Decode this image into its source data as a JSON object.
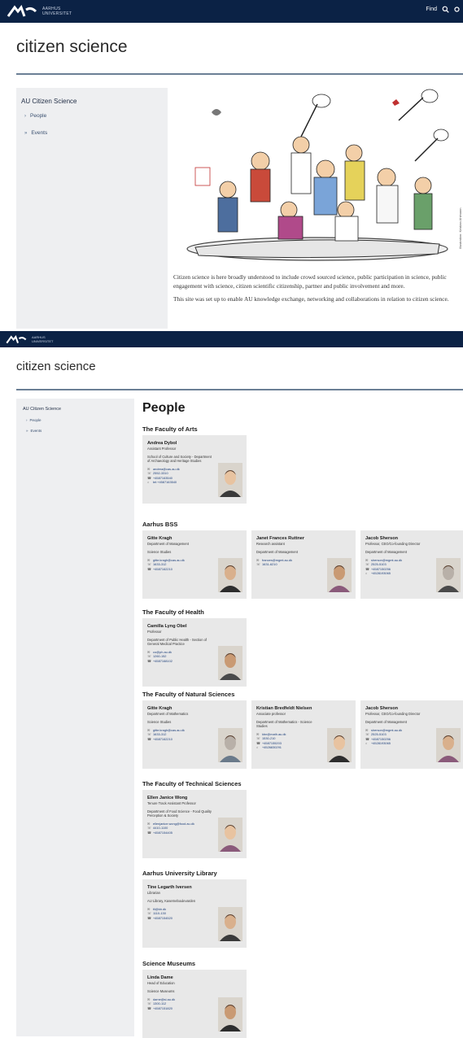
{
  "header": {
    "university": "Aarhus Universitet",
    "menu_label": "Find"
  },
  "site_title": "citizen science",
  "sidebar": {
    "heading": "AU Citizen Science",
    "items": [
      {
        "label": "People",
        "icon": "chevron-right-icon"
      },
      {
        "label": "Events",
        "icon": "double-chevron-icon"
      }
    ]
  },
  "hero": {
    "credit": "Illustration: Kristian Ahlmann",
    "paragraphs": [
      "Citizen science is here broadly understood to include crowd sourced science, public participation in science, public engagement with science, citizen scientific citizenship, partner and public involvement and more.",
      "This site was set up to enable AU knowledge exchange, networking and collaborations in relation to citizen science."
    ]
  },
  "people_page": {
    "title": "People",
    "groups": [
      {
        "name": "The Faculty of Arts",
        "people": [
          {
            "name": "Andrea Dybol",
            "role": "Assistant Professor",
            "dept": "School of Culture and Society - Department of Archaeology and Heritage Studies",
            "contacts": [
              "andrea@cas.au.dk",
              "2552-3310",
              "+4587163540",
              "tel:+4587163540"
            ]
          }
        ]
      },
      {
        "name": "Aarhus BSS",
        "people": [
          {
            "name": "Gitte Kragh",
            "role": "Department of Management",
            "dept": "Science Studies",
            "contacts": [
              "gitte.kragh@cas.au.dk",
              "1633-312",
              "+4587162210"
            ]
          },
          {
            "name": "Janet Frances Ruttner",
            "role": "Research assistant",
            "dept": "Department of Management",
            "contacts": [
              "frances@mgmt.au.dk",
              "1631-6210"
            ]
          },
          {
            "name": "Jacob Sherson",
            "role": "Professor, CEO/Co-founding Director",
            "dept": "Department of Management",
            "contacts": [
              "sherson@mgmt.au.dk",
              "2525-5103",
              "+4587150256",
              "+4528193065"
            ]
          }
        ]
      },
      {
        "name": "The Faculty of Health",
        "people": [
          {
            "name": "Camilla Lyng Obel",
            "role": "Professor",
            "dept": "Department of Public Health - Section of General Medical Practice",
            "contacts": [
              "co@ph.au.dk",
              "1260-152",
              "+4587168102"
            ]
          }
        ]
      },
      {
        "name": "The Faculty of Natural Sciences",
        "people": [
          {
            "name": "Gitte Kragh",
            "role": "Department of Mathematics",
            "dept": "Science Studies",
            "contacts": [
              "gitte.kragh@cas.au.dk",
              "1633-312",
              "+4587162210"
            ]
          },
          {
            "name": "Kristian Bredfeldt Nielsen",
            "role": "Associate professor",
            "dept": "Department of Mathematics - Science Studies",
            "contacts": [
              "kbn@math.au.dk",
              "1530-210",
              "+4587155203",
              "+4526830291"
            ]
          },
          {
            "name": "Jacob Sherson",
            "role": "Professor, CEO/Co-founding Director",
            "dept": "Department of Management",
            "contacts": [
              "sherson@mgmt.au.dk",
              "2525-5103",
              "+4587150256",
              "+4528193065"
            ]
          }
        ]
      },
      {
        "name": "The Faculty of Technical Sciences",
        "people": [
          {
            "name": "Ellen Janice Wong",
            "role": "Tenure Track Assistant Professor",
            "dept": "Department of Food Science - Food Quality Perception & Society",
            "contacts": [
              "ellenjanice.wong@food.au.dk",
              "4410-1100",
              "+4587154405"
            ]
          }
        ]
      },
      {
        "name": "Aarhus University Library",
        "people": [
          {
            "name": "Tine Legarth Iversen",
            "role": "Librarian",
            "dept": "AU Library, Kaserneboulevarden",
            "contacts": [
              "tli@kb.dk",
              "1110-130",
              "+4587154520"
            ]
          }
        ]
      },
      {
        "name": "Science Museums",
        "people": [
          {
            "name": "Linda Dame",
            "role": "Head of Education",
            "dept": "Science Museums",
            "contacts": [
              "dame@si.au.dk",
              "1300-112",
              "+4587151820"
            ]
          }
        ]
      }
    ]
  },
  "colors": {
    "navy": "#0b2245",
    "sidebar_bg": "#eeeff1",
    "card_bg": "#e8e8e8",
    "rule": "#6b7f95"
  }
}
